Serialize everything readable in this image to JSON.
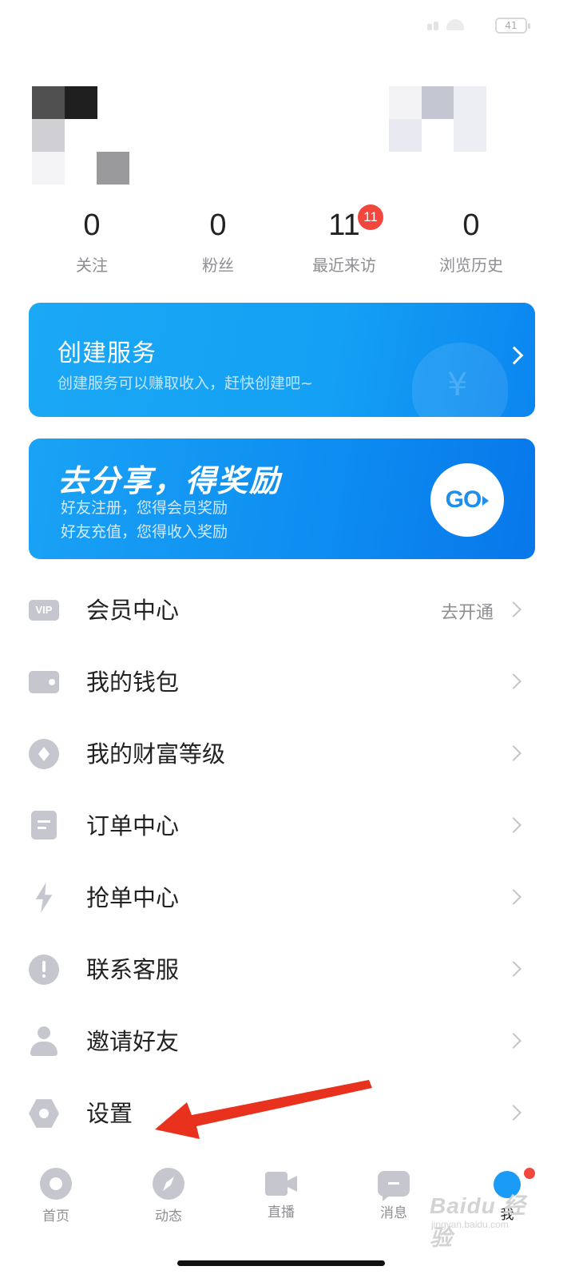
{
  "status_bar": {
    "battery_level": "41"
  },
  "stats": [
    {
      "value": "0",
      "label": "关注"
    },
    {
      "value": "0",
      "label": "粉丝"
    },
    {
      "value": "11",
      "label": "最近来访",
      "badge": "11"
    },
    {
      "value": "0",
      "label": "浏览历史"
    }
  ],
  "service_banner": {
    "title": "创建服务",
    "subtitle": "创建服务可以赚取收入，赶快创建吧~"
  },
  "share_banner": {
    "title": "去分享，得奖励",
    "line1": "好友注册，您得会员奖励",
    "line2": "好友充值，您得收入奖励",
    "button": "GO"
  },
  "menu": {
    "vip": {
      "label": "会员中心",
      "right": "去开通",
      "icon": "vip-icon"
    },
    "wallet": {
      "label": "我的钱包",
      "icon": "wallet-icon"
    },
    "wealth": {
      "label": "我的财富等级",
      "icon": "diamond-icon"
    },
    "orders": {
      "label": "订单中心",
      "icon": "order-icon"
    },
    "grab": {
      "label": "抢单中心",
      "icon": "lightning-icon"
    },
    "support": {
      "label": "联系客服",
      "icon": "alert-icon"
    },
    "invite": {
      "label": "邀请好友",
      "icon": "user-icon"
    },
    "settings": {
      "label": "设置",
      "icon": "gear-icon"
    }
  },
  "vip_icon_text": "VIP",
  "tabs": [
    {
      "label": "首页",
      "icon": "home-icon"
    },
    {
      "label": "动态",
      "icon": "compass-icon"
    },
    {
      "label": "直播",
      "icon": "video-icon"
    },
    {
      "label": "消息",
      "icon": "message-icon"
    },
    {
      "label": "我",
      "icon": "profile-icon",
      "active": true
    }
  ],
  "watermark": {
    "brand": "Baidu 经验",
    "url": "jingyan.baidu.com"
  },
  "colors": {
    "accent_blue": "#1a9bf5",
    "badge_red": "#f2473c",
    "annotation_arrow": "#e8321e",
    "icon_gray": "#c6c7ce"
  }
}
